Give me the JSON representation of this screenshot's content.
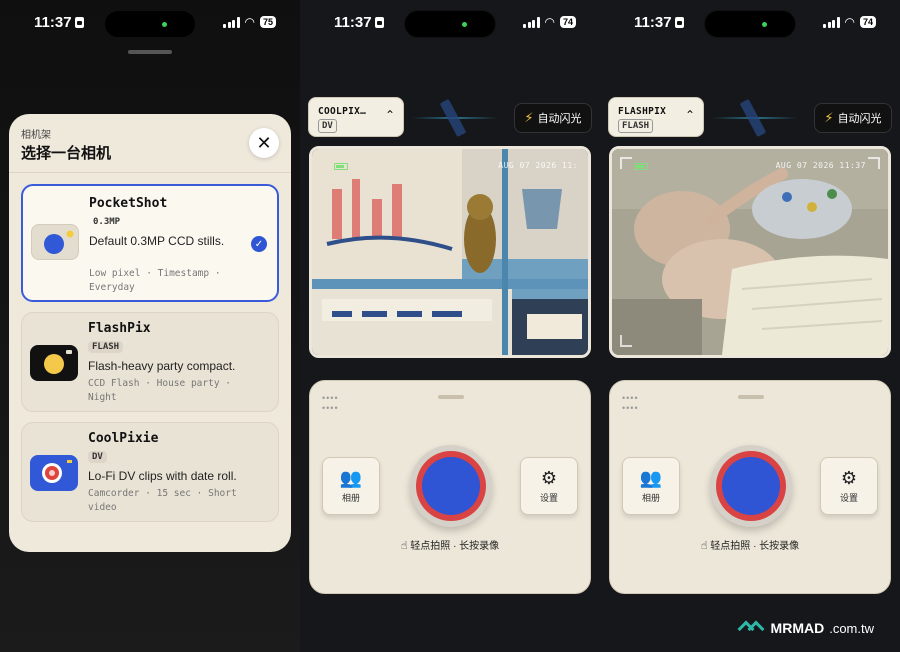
{
  "status_bar": [
    {
      "time": "11:37",
      "battery": "75"
    },
    {
      "time": "11:37",
      "battery": "74"
    },
    {
      "time": "11:37",
      "battery": "74"
    }
  ],
  "picker": {
    "kicker": "相机架",
    "title": "选择一台相机",
    "close_label": "✕",
    "cameras": [
      {
        "name": "PocketShot",
        "badge": "0.3MP",
        "desc": "Default 0.3MP CCD stills.",
        "tags": "Low pixel · Timestamp · Everyday",
        "selected": true,
        "icon": "pocket-camera-icon"
      },
      {
        "name": "FlashPix",
        "badge": "FLASH",
        "desc": "Flash-heavy party compact.",
        "tags": "CCD Flash · House party · Night",
        "selected": false,
        "icon": "flash-camera-icon"
      },
      {
        "name": "CoolPixie",
        "badge": "DV",
        "desc": "Lo-Fi DV clips with date roll.",
        "tags": "Camcorder · 15 sec · Short video",
        "selected": false,
        "icon": "dv-camera-icon"
      }
    ]
  },
  "screens": [
    {
      "model": "COOLPIX…",
      "mode": "DV",
      "flash_label": "自动闪光",
      "timestamp": "AUG 07 2026 11:",
      "album_label": "相册",
      "settings_label": "设置",
      "hint": "轻点拍照 · 长按录像"
    },
    {
      "model": "FLASHPIX",
      "mode": "FLASH",
      "flash_label": "自动闪光",
      "timestamp": "AUG 07 2026 11:37",
      "album_label": "相册",
      "settings_label": "设置",
      "hint": "轻点拍照 · 长按录像"
    }
  ],
  "watermark": {
    "brand": "MRMAD",
    "tld": ".com.tw"
  },
  "colors": {
    "accent": "#2f55d4",
    "shutter_ring": "#d94343",
    "cream": "#efe9dc",
    "flash_icon": "#f5c445"
  }
}
